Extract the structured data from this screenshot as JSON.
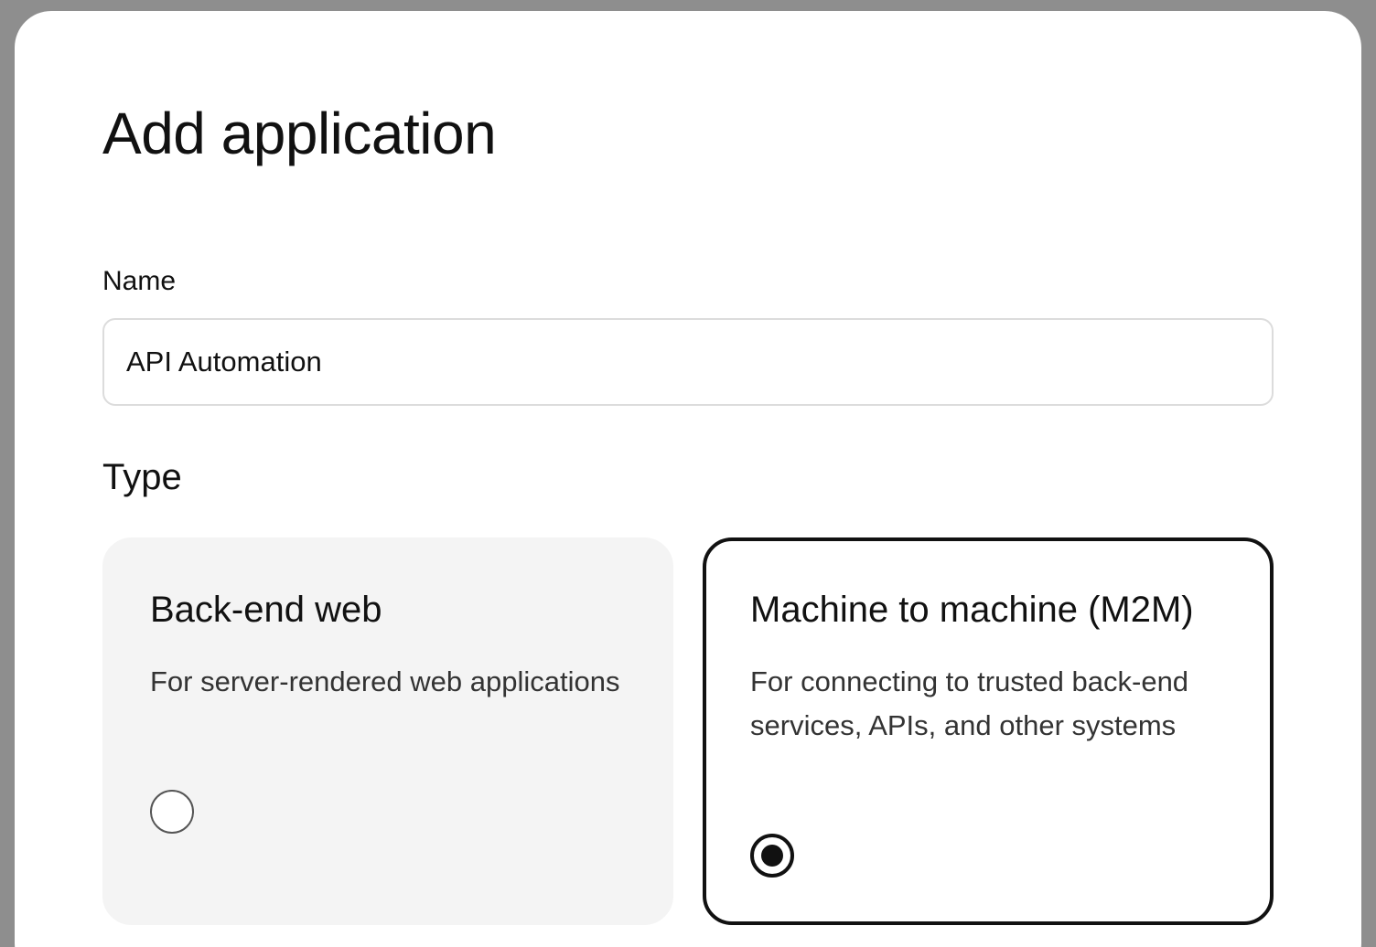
{
  "modal": {
    "title": "Add application"
  },
  "name_field": {
    "label": "Name",
    "value": "API Automation"
  },
  "type_section": {
    "title": "Type",
    "options": [
      {
        "title": "Back-end web",
        "description": "For server-rendered web applications",
        "selected": false
      },
      {
        "title": "Machine to machine (M2M)",
        "description": "For connecting to trusted back-end services, APIs, and other systems",
        "selected": true
      }
    ]
  },
  "colors": {
    "backdrop": "#8e8e8e",
    "text": "#111111",
    "card_unselected_bg": "#f4f4f4",
    "selected_border": "#111111"
  }
}
